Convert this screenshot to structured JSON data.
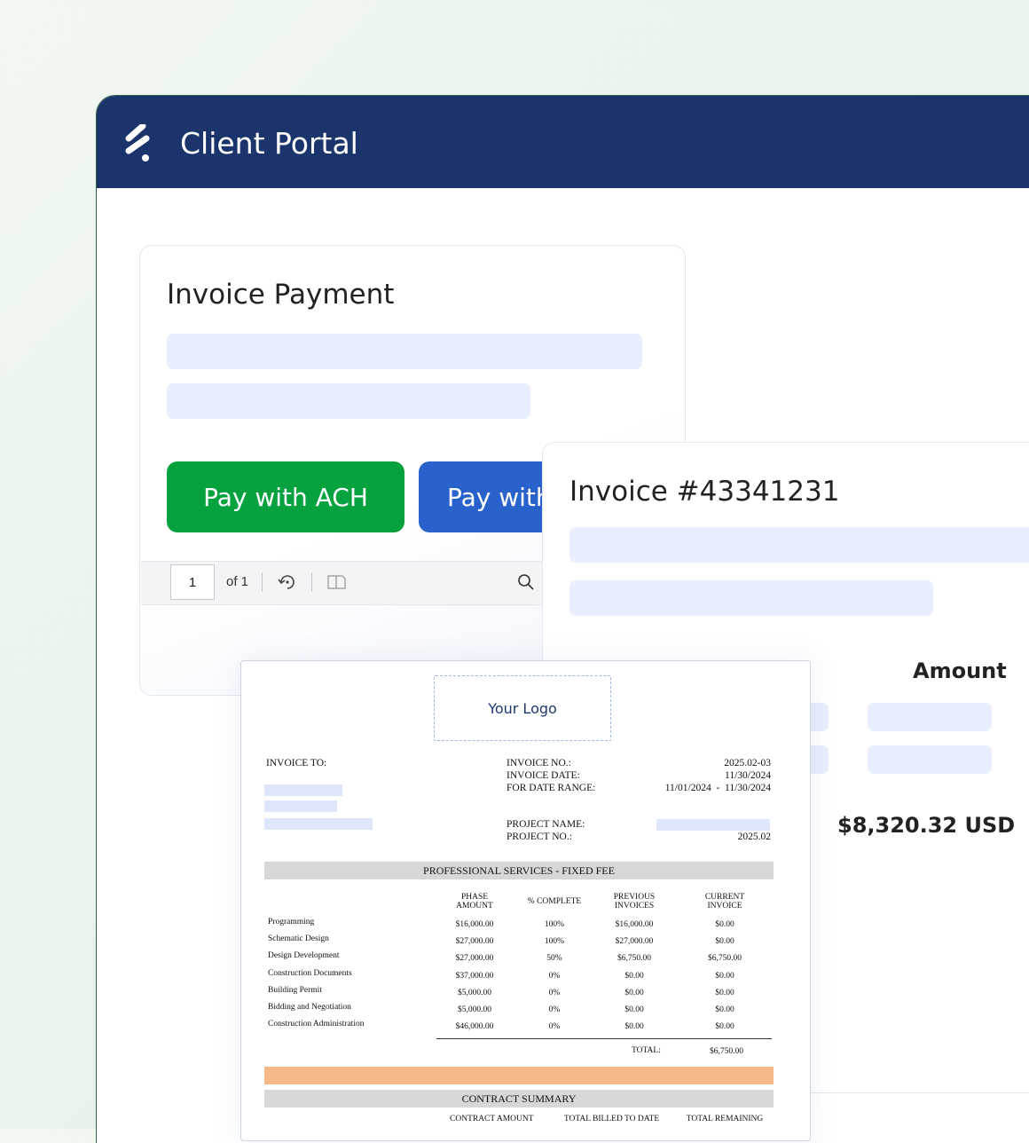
{
  "app": {
    "title": "Client Portal"
  },
  "payment_card": {
    "title": "Invoice Payment",
    "ach_button": "Pay with ACH",
    "other_button": "Pay with",
    "pdf_toolbar": {
      "page": "1",
      "of_label": "of 1"
    }
  },
  "invoice_card": {
    "title": "Invoice #43341231",
    "amount_label": "Amount",
    "total": "$8,320.32 USD"
  },
  "document": {
    "logo_placeholder": "Your Logo",
    "invoice_to_label": "INVOICE TO:",
    "meta": [
      {
        "label": "INVOICE NO.:",
        "value": "2025.02-03"
      },
      {
        "label": "INVOICE DATE:",
        "value": "11/30/2024"
      },
      {
        "label": "FOR DATE RANGE:",
        "value": "11/01/2024  -  11/30/2024"
      }
    ],
    "project_name_label": "PROJECT NAME:",
    "project_no_label": "PROJECT NO.:",
    "project_no": "2025.02",
    "services_header": "PROFESSIONAL SERVICES - FIXED FEE",
    "columns": [
      "PHASE AMOUNT",
      "% COMPLETE",
      "PREVIOUS INVOICES",
      "CURRENT INVOICE"
    ],
    "column_lines": [
      [
        "PHASE",
        "AMOUNT"
      ],
      [
        "% COMPLETE"
      ],
      [
        "PREVIOUS",
        "INVOICES"
      ],
      [
        "CURRENT",
        "INVOICE"
      ]
    ],
    "rows": [
      {
        "phase": "Programming",
        "amount": "$16,000.00",
        "complete": "100%",
        "previous": "$16,000.00",
        "current": "$0.00"
      },
      {
        "phase": "Schematic Design",
        "amount": "$27,000.00",
        "complete": "100%",
        "previous": "$27,000.00",
        "current": "$0.00"
      },
      {
        "phase": "Design Development",
        "amount": "$27,000.00",
        "complete": "50%",
        "previous": "$6,750.00",
        "current": "$6,750.00"
      },
      {
        "phase": "Construction Documents",
        "amount": "$37,000.00",
        "complete": "0%",
        "previous": "$0.00",
        "current": "$0.00"
      },
      {
        "phase": "Building Permit",
        "amount": "$5,000.00",
        "complete": "0%",
        "previous": "$0.00",
        "current": "$0.00"
      },
      {
        "phase": "Bidding and Negotiation",
        "amount": "$5,000.00",
        "complete": "0%",
        "previous": "$0.00",
        "current": "$0.00"
      },
      {
        "phase": "Construction Administration",
        "amount": "$46,000.00",
        "complete": "0%",
        "previous": "$0.00",
        "current": "$0.00"
      }
    ],
    "total_label": "TOTAL:",
    "total_value": "$6,750.00",
    "contract_summary_header": "CONTRACT SUMMARY",
    "summary_columns": [
      "CONTRACT AMOUNT",
      "TOTAL BILLED TO DATE",
      "TOTAL REMAINING"
    ]
  },
  "colors": {
    "header": "#1b356c",
    "ach_button": "#06a23f",
    "other_button": "#2a62cc",
    "skeleton": "#e8eefb",
    "orange_bar": "#f7b987"
  }
}
